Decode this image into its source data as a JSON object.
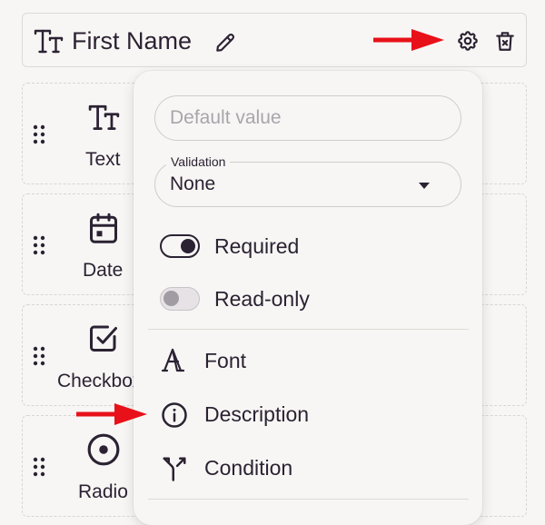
{
  "field": {
    "title": "First Name",
    "type_icon": "text-type-icon",
    "edit_icon": "pencil-icon",
    "settings_icon": "gear-icon",
    "delete_icon": "trash-icon"
  },
  "palette": {
    "items": [
      {
        "label": "Text",
        "icon": "text-type-icon"
      },
      {
        "label": "Date",
        "icon": "calendar-icon"
      },
      {
        "label": "Checkbox",
        "icon": "checkbox-icon"
      },
      {
        "label": "Radio",
        "icon": "radio-icon"
      }
    ]
  },
  "settings": {
    "default_value_placeholder": "Default value",
    "validation": {
      "label": "Validation",
      "value": "None"
    },
    "toggles": [
      {
        "label": "Required",
        "on": true
      },
      {
        "label": "Read-only",
        "on": false
      }
    ],
    "menu": [
      {
        "label": "Font",
        "icon": "font-icon"
      },
      {
        "label": "Description",
        "icon": "info-icon"
      },
      {
        "label": "Condition",
        "icon": "condition-branch-icon"
      }
    ]
  },
  "colors": {
    "background": "#f8f6f4",
    "text": "#2b2233",
    "annotation_arrow": "#e8111a"
  }
}
